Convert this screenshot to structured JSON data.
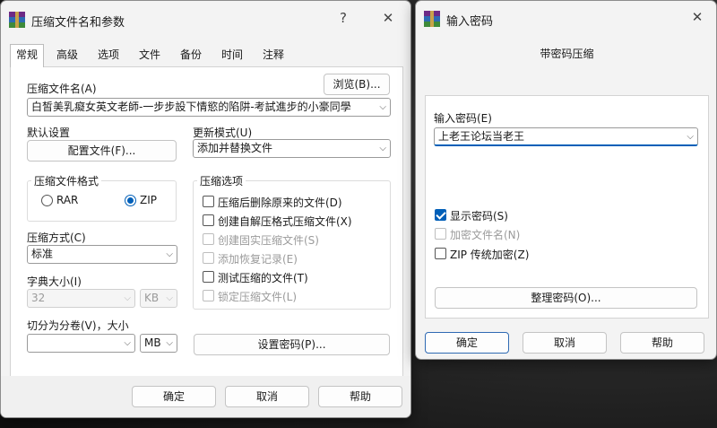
{
  "main": {
    "title": "压缩文件名和参数",
    "help_glyph": "?",
    "close_glyph": "✕",
    "tabs": [
      "常规",
      "高级",
      "选项",
      "文件",
      "备份",
      "时间",
      "注释"
    ],
    "archive_name_label": "压缩文件名(A)",
    "browse_button": "浏览(B)...",
    "archive_name_value": "白皙美乳癡女英文老師-一步步設下情慾的陷阱-考試進步的小豪同學",
    "default_settings_label": "默认设置",
    "profiles_button": "配置文件(F)...",
    "update_mode_label": "更新模式(U)",
    "update_mode_value": "添加并替换文件",
    "format_group_title": "压缩文件格式",
    "format_rar": "RAR",
    "format_zip": "ZIP",
    "method_label": "压缩方式(C)",
    "method_value": "标准",
    "dict_label": "字典大小(I)",
    "dict_value": "32",
    "dict_unit": "KB",
    "split_label": "切分为分卷(V)，大小",
    "split_value": "",
    "split_unit": "MB",
    "options_group_title": "压缩选项",
    "options": [
      {
        "label": "压缩后删除原来的文件(D)",
        "checked": false,
        "enabled": true
      },
      {
        "label": "创建自解压格式压缩文件(X)",
        "checked": false,
        "enabled": true
      },
      {
        "label": "创建固实压缩文件(S)",
        "checked": false,
        "enabled": false
      },
      {
        "label": "添加恢复记录(E)",
        "checked": false,
        "enabled": false
      },
      {
        "label": "测试压缩的文件(T)",
        "checked": false,
        "enabled": true
      },
      {
        "label": "锁定压缩文件(L)",
        "checked": false,
        "enabled": false
      }
    ],
    "set_password_button": "设置密码(P)...",
    "ok_button": "确定",
    "cancel_button": "取消",
    "help_button": "帮助"
  },
  "password": {
    "title": "输入密码",
    "close_glyph": "✕",
    "heading": "带密码压缩",
    "enter_label": "输入密码(E)",
    "password_value": "上老王论坛当老王",
    "show_password": "显示密码(S)",
    "encrypt_names": "加密文件名(N)",
    "zip_legacy": "ZIP 传统加密(Z)",
    "organize_button": "整理密码(O)...",
    "ok_button": "确定",
    "cancel_button": "取消",
    "help_button": "帮助"
  },
  "glyphs": {
    "chevron": "⌵"
  }
}
